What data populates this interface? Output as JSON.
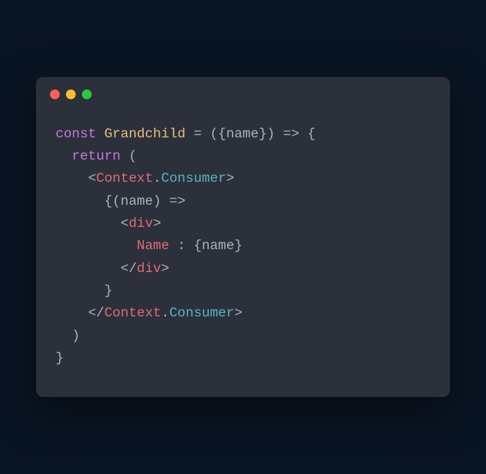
{
  "code": {
    "line1": {
      "const": "const",
      "name": "Grandchild",
      "eq": " = ",
      "params": "({name})",
      "arrow": " => ",
      "brace": "{"
    },
    "line2": {
      "return": "return",
      "paren": " ("
    },
    "line3": {
      "lt": "<",
      "ctx": "Context",
      "dot": ".",
      "cons": "Consumer",
      "gt": ">"
    },
    "line4": {
      "content": "{(name) => "
    },
    "line5": {
      "lt": "<",
      "div": "div",
      "gt": ">"
    },
    "line6": {
      "nameword": "Name",
      "rest": " : {name}"
    },
    "line7": {
      "lt": "</",
      "div": "div",
      "gt": ">"
    },
    "line8": {
      "brace": "}"
    },
    "line9": {
      "lt": "</",
      "ctx": "Context",
      "dot": ".",
      "cons": "Consumer",
      "gt": ">"
    },
    "line10": {
      "paren": ")"
    },
    "line11": {
      "brace": "}"
    }
  }
}
